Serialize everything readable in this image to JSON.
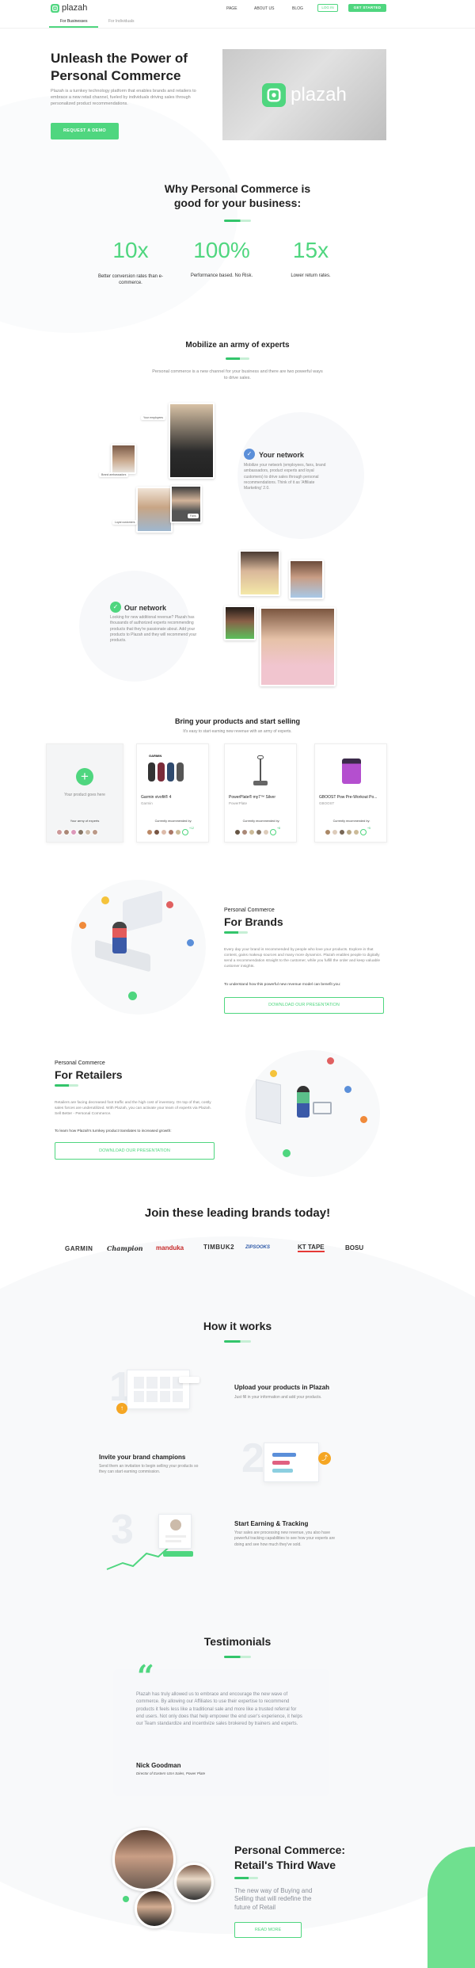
{
  "nav": {
    "logo_text": "plazah",
    "links": [
      "PAGE",
      "ABOUT US",
      "BLOG"
    ],
    "login": "LOG IN",
    "get_started": "GET STARTED",
    "tabs": [
      "For Businesses",
      "For Individuals"
    ]
  },
  "hero": {
    "title_line1": "Unleash the Power of",
    "title_line2": "Personal Commerce",
    "description": "Plazah is a turnkey technology platform that enables brands and retailers to embrace a new retail channel, fueled by individuals driving sales through personalized product recommendations.",
    "cta": "REQUEST A DEMO",
    "logo_text": "plazah"
  },
  "why": {
    "title_line1": "Why Personal Commerce is",
    "title_line2": "good for your business:",
    "stats": [
      {
        "value": "10x",
        "label": "Better conversion rates than e-commerce."
      },
      {
        "value": "100%",
        "label": "Performance based. No Risk."
      },
      {
        "value": "15x",
        "label": "Lower return rates."
      }
    ]
  },
  "mobilize": {
    "title": "Mobilize an army of experts",
    "subtitle": "Personal commerce is a new channel for your business and there are two powerful ways to drive sales.",
    "your_network_title": "Your network",
    "your_network_text": "Mobilize your network (employees, fans, brand ambassadors, product experts and loyal customers) to drive sales through personal recommendations. Think of it as 'Affiliate Marketing' 2.0.",
    "our_network_title": "Our network",
    "our_network_text": "Looking for new additional revenue? Plazah has thousands of authorized experts recommending products that they're passionate about. Add your products to Plazah and they will recommend your products.",
    "chips": [
      "Your employees",
      "Brand ambassadors",
      "Loyal customers",
      "Fans"
    ]
  },
  "bring": {
    "title": "Bring your products and start selling",
    "subtitle": "It's easy to start earning new revenue with an army of experts.",
    "placeholder_card": {
      "label": "Your product goes here",
      "experts_label": "Your army of experts"
    },
    "products": [
      {
        "brand_tag": "GARMIN",
        "name": "Garmin vivofit® 4",
        "brand": "Garmin",
        "recommended_label": "Currently recommended by:",
        "more": "+12"
      },
      {
        "brand_tag": "",
        "name": "PowerPlate® my7™ Silver",
        "brand": "PowerPlate",
        "recommended_label": "Currently recommended by:",
        "more": "+8"
      },
      {
        "brand_tag": "",
        "name": "GBOOST Pow Pre-Workout Po...",
        "brand": "GBOOST",
        "recommended_label": "Currently recommended by:",
        "more": "+5"
      }
    ]
  },
  "brands_section": {
    "kicker": "Personal Commerce",
    "title": "For Brands",
    "text": "Every day your brand is recommended by people who love your products. Explore in that content, gains makeup sources and many more dynamics. Plazah enables people to digitally send a recommendation straight to the customer, while you fulfill the order and keep valuable customer insights.",
    "link_text": "To understand how this powerful new revenue model can benefit you:",
    "cta": "DOWNLOAD OUR PRESENTATION"
  },
  "retailers_section": {
    "kicker": "Personal Commerce",
    "title": "For Retailers",
    "text": "Retailers are facing decreased foot traffic and the high cost of inventory. On top of that, costly sales forces are underutilized. With Plazah, you can activate your team of experts via Plazah. Sell Better - Personal Commerce.",
    "link_text": "To learn how Plazah's turnkey product translates to increased growth:",
    "cta": "DOWNLOAD OUR PRESENTATION"
  },
  "leaders": {
    "title": "Join these leading brands today!",
    "brands": [
      "GARMIN",
      "Champion",
      "manduka",
      "TIMBUK2",
      "ZIPSOOKS",
      "KT TAPE",
      "BOSU"
    ]
  },
  "how": {
    "title": "How it works",
    "steps": [
      {
        "num": "1",
        "title": "Upload your products in Plazah",
        "text": "Just fill in your information and add your products."
      },
      {
        "num": "2",
        "title": "Invite your brand champions",
        "text": "Send them an invitation to begin selling your products so they can start earning commission."
      },
      {
        "num": "3",
        "title": "Start Earning & Tracking",
        "text": "Your sales are processing new revenue, you also have powerful tracking capabilities to see how your experts are doing and see how much they've sold."
      }
    ]
  },
  "testimonials": {
    "title": "Testimonials",
    "quote": "Plazah has truly allowed us to embrace and encourage the new wave of commerce. By allowing our Affiliates to use their expertise to recommend products it feels less like a traditional sale and more like a trusted referral for end users. Not only does that help empower the end user's experience, it helps our Team standardize and incentivize sales brokered by trainers and experts.",
    "name": "Nick Goodman",
    "role": "Director of Eastern USA Sales, Power Plate"
  },
  "retail_wave": {
    "title_line1": "Personal Commerce:",
    "title_line2": "Retail's Third Wave",
    "text": "The new way of Buying and Selling that will redefine the future of Retail",
    "cta": "READ MORE"
  },
  "colors": {
    "accent": "#4fd67f",
    "accent_dark": "#33c56b",
    "text": "#2a2a2a"
  }
}
